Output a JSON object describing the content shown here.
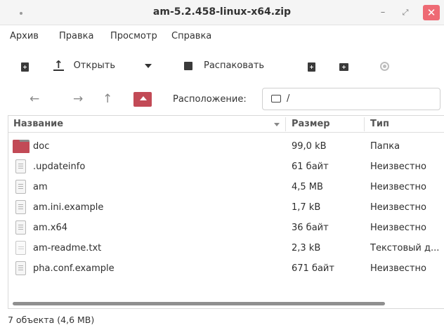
{
  "window": {
    "title": "am-5.2.458-linux-x64.zip",
    "min_icon": "minimize-icon",
    "max_icon": "maximize-icon",
    "close_icon": "close-icon",
    "close_color": "#ee6a74"
  },
  "menu": {
    "items": [
      "Архив",
      "Правка",
      "Просмотр",
      "Справка"
    ]
  },
  "toolbar": {
    "open_label": "Открыть",
    "extract_label": "Распаковать",
    "new_archive_icon": "new-archive-icon",
    "open_icon": "upload-arrow-icon",
    "dropdown_icon": "dropdown-triangle-icon",
    "extract_icon": "extract-icon",
    "add_file_icon": "add-file-icon",
    "add_folder_icon": "add-folder-icon",
    "stop_icon": "stop-icon"
  },
  "navigation": {
    "back_icon": "back-arrow-icon",
    "forward_icon": "forward-arrow-icon",
    "up_icon": "up-arrow-icon",
    "home_icon": "home-folder-icon",
    "location_label": "Расположение:",
    "location_value": "/",
    "accent_color": "#c24a56"
  },
  "columns": {
    "name": "Название",
    "size": "Размер",
    "type": "Тип"
  },
  "files": [
    {
      "name": "doc",
      "size": "99,0 kB",
      "type": "Папка",
      "icon": "folder"
    },
    {
      "name": ".updateinfo",
      "size": "61 байт",
      "type": "Неизвестно",
      "icon": "file"
    },
    {
      "name": "am",
      "size": "4,5 MB",
      "type": "Неизвестно",
      "icon": "file"
    },
    {
      "name": "am.ini.example",
      "size": "1,7 kB",
      "type": "Неизвестно",
      "icon": "file"
    },
    {
      "name": "am.x64",
      "size": "36 байт",
      "type": "Неизвестно",
      "icon": "file"
    },
    {
      "name": "am-readme.txt",
      "size": "2,3 kB",
      "type": "Текстовый д...",
      "icon": "text"
    },
    {
      "name": "pha.conf.example",
      "size": "671 байт",
      "type": "Неизвестно",
      "icon": "file"
    }
  ],
  "status": {
    "text": "7 объекта (4,6 MB)"
  }
}
